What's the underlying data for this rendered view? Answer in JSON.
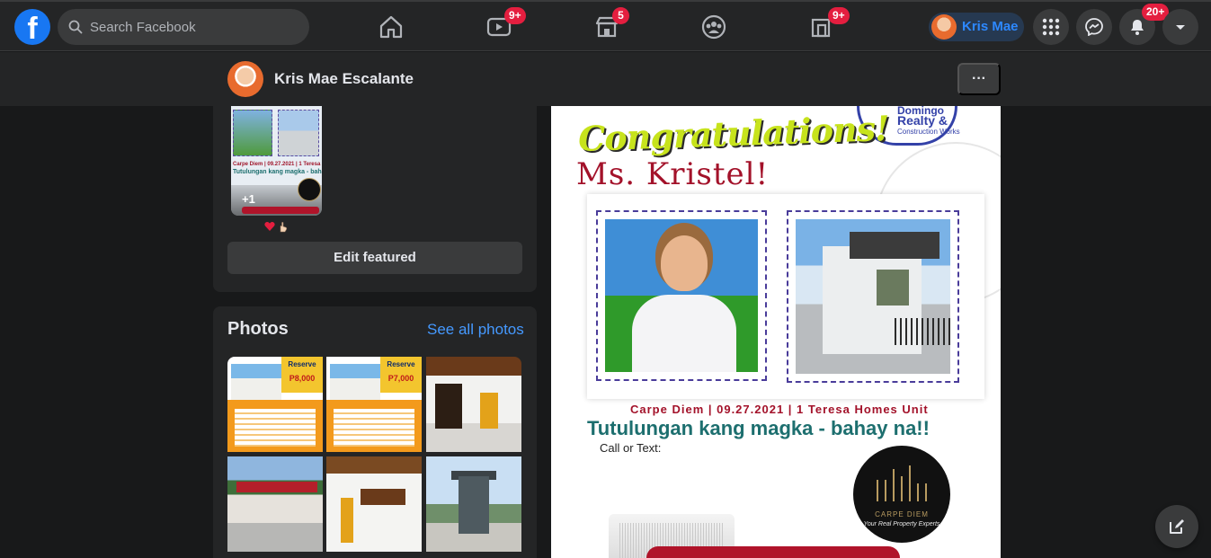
{
  "nav": {
    "search_placeholder": "Search Facebook",
    "badges": {
      "watch": "9+",
      "marketplace": "5",
      "gaming": "9+",
      "notifications": "20+"
    },
    "profile_name": "Kris Mae"
  },
  "profile_header": {
    "name": "Kris Mae Escalante",
    "more_label": "···"
  },
  "featured": {
    "more_count": "+1",
    "edit_label": "Edit featured"
  },
  "photos": {
    "title": "Photos",
    "see_all_label": "See all photos",
    "flyer1_reserve": "Reserve",
    "flyer1_price": "P8,000",
    "flyer2_reserve": "Reserve",
    "flyer2_price": "P7,000"
  },
  "post": {
    "headline": "Congratulations!",
    "recipient": "Ms. Kristel!",
    "company_line1": "Domingo",
    "company_line2": "Realty &",
    "company_line3": "Construction Works",
    "details": "Carpe Diem | 09.27.2021 | 1 Teresa Homes Unit",
    "tagline": "Tutulungan kang magka - bahay na!!",
    "contact": "Call or Text:",
    "logo_name": "CARPE DIEM",
    "logo_tagline": "Your Real Property Experts"
  },
  "colors": {
    "background": "#18191a",
    "surface": "#242526",
    "button": "#3a3b3c",
    "accent": "#2d88ff",
    "badge": "#e41e3f"
  }
}
